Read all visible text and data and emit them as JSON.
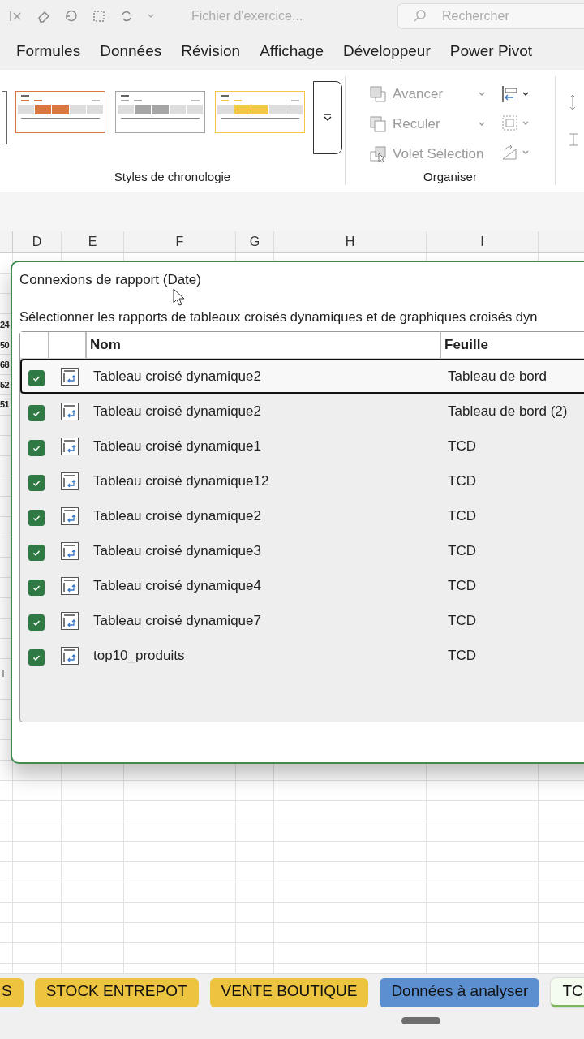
{
  "title_bar": {
    "title": "Fichier d'exercice...",
    "search": {
      "placeholder": "Rechercher"
    }
  },
  "menu_tabs": [
    {
      "label": "Formules"
    },
    {
      "label": "Données"
    },
    {
      "label": "Révision"
    },
    {
      "label": "Affichage"
    },
    {
      "label": "Développeur"
    },
    {
      "label": "Power Pivot"
    }
  ],
  "ribbon": {
    "timeline_styles": {
      "label": "Styles de chronologie",
      "styles": [
        {
          "color": "#d9773f"
        },
        {
          "color": "#a6a6a6"
        },
        {
          "color": "#f2c744"
        }
      ]
    },
    "organiser": {
      "label": "Organiser",
      "commands": [
        {
          "kind": "forward",
          "label": "Avancer",
          "disabled": true
        },
        {
          "kind": "backward",
          "label": "Reculer",
          "disabled": true
        },
        {
          "kind": "pane",
          "label": "Volet Sélection",
          "disabled": true
        }
      ]
    }
  },
  "columns": [
    "D",
    "E",
    "F",
    "G",
    "H",
    "I"
  ],
  "row_fragments": [
    "24",
    "50",
    "68",
    "52",
    "51"
  ],
  "row_fragment_lower": "T",
  "dialog": {
    "title": "Connexions de rapport (Date)",
    "description": "Sélectionner les rapports de tableaux croisés dynamiques et de graphiques croisés dyn",
    "headers": {
      "name": "Nom",
      "sheet": "Feuille"
    },
    "rows": [
      {
        "checked": true,
        "name": "Tableau croisé dynamique2",
        "sheet": "Tableau de bord",
        "selected": true
      },
      {
        "checked": true,
        "name": "Tableau croisé dynamique2",
        "sheet": "Tableau de bord (2)",
        "selected": false
      },
      {
        "checked": true,
        "name": "Tableau croisé dynamique1",
        "sheet": "TCD",
        "selected": false
      },
      {
        "checked": true,
        "name": "Tableau croisé dynamique12",
        "sheet": "TCD",
        "selected": false
      },
      {
        "checked": true,
        "name": "Tableau croisé dynamique2",
        "sheet": "TCD",
        "selected": false
      },
      {
        "checked": true,
        "name": "Tableau croisé dynamique3",
        "sheet": "TCD",
        "selected": false
      },
      {
        "checked": true,
        "name": "Tableau croisé dynamique4",
        "sheet": "TCD",
        "selected": false
      },
      {
        "checked": true,
        "name": "Tableau croisé dynamique7",
        "sheet": "TCD",
        "selected": false
      },
      {
        "checked": true,
        "name": "top10_produits",
        "sheet": "TCD",
        "selected": false
      }
    ]
  },
  "sheet_tabs": [
    {
      "label": "S",
      "color": "#ecc440",
      "selected": false
    },
    {
      "label": "STOCK ENTREPOT",
      "color": "#ecc440",
      "selected": false
    },
    {
      "label": "VENTE BOUTIQUE",
      "color": "#ecc440",
      "selected": false
    },
    {
      "label": "Données à analyser",
      "color": "#5b8fd0",
      "selected": false
    },
    {
      "label": "TC",
      "color": "#7fb55a",
      "selected": true
    }
  ]
}
